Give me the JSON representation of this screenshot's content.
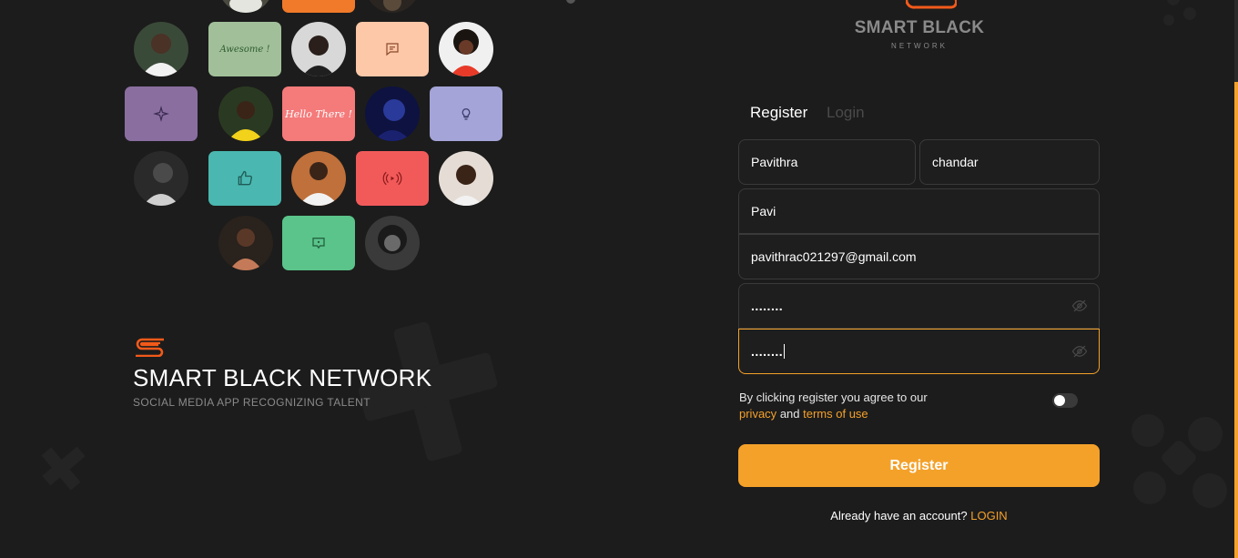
{
  "brand": {
    "name": "SMART BLACK NETWORK",
    "tagline": "SOCIAL MEDIA APP RECOGNIZING TALENT",
    "top_title": "SMART BLACK",
    "top_subtitle": "NETWORK"
  },
  "collage": {
    "tile_awesome": "Awesome !",
    "tile_hello": "Hello There !"
  },
  "tabs": {
    "register": "Register",
    "login": "Login"
  },
  "form": {
    "first_name": "Pavithra",
    "last_name": "chandar",
    "username": "Pavi",
    "email": "pavithrac021297@gmail.com",
    "password": "........",
    "confirm_password": "........"
  },
  "terms": {
    "prefix": "By clicking register you agree to our",
    "privacy": "privacy",
    "and": "and",
    "terms_of_use": "terms of use"
  },
  "register_button": "Register",
  "footer": {
    "already": "Already have an account?",
    "login": "LOGIN"
  },
  "colors": {
    "accent": "#f4a12a",
    "background": "#1c1c1c"
  }
}
